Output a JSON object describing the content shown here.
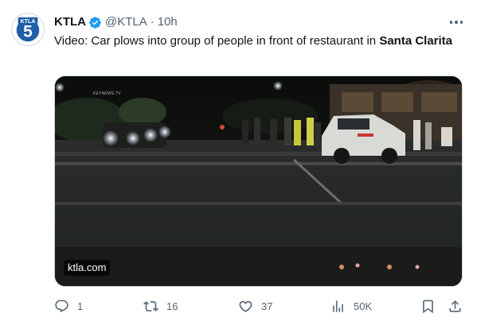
{
  "account": {
    "name": "KTLA",
    "handle": "@KTLA",
    "separator": "·",
    "time": "10h",
    "avatar_icon": "ktla-5-logo",
    "avatar_text": "KTLA",
    "verified_icon": "verified-badge-icon",
    "colors": {
      "verified": "#1d9bf0",
      "logo_blue": "#1f5fa8"
    }
  },
  "tweet": {
    "text_plain": "Video: Car plows into group of people in front of restaurant in ",
    "text_bold": "Santa Clarita"
  },
  "media": {
    "source_badge": "ktla.com",
    "watermark": "KEYNEWS.TV"
  },
  "actions": {
    "reply": {
      "icon": "reply-icon",
      "count": "1"
    },
    "retweet": {
      "icon": "retweet-icon",
      "count": "16"
    },
    "like": {
      "icon": "heart-icon",
      "count": "37"
    },
    "views": {
      "icon": "views-chart-icon",
      "count": "50K"
    },
    "bookmark": {
      "icon": "bookmark-icon"
    },
    "share": {
      "icon": "share-icon"
    }
  }
}
